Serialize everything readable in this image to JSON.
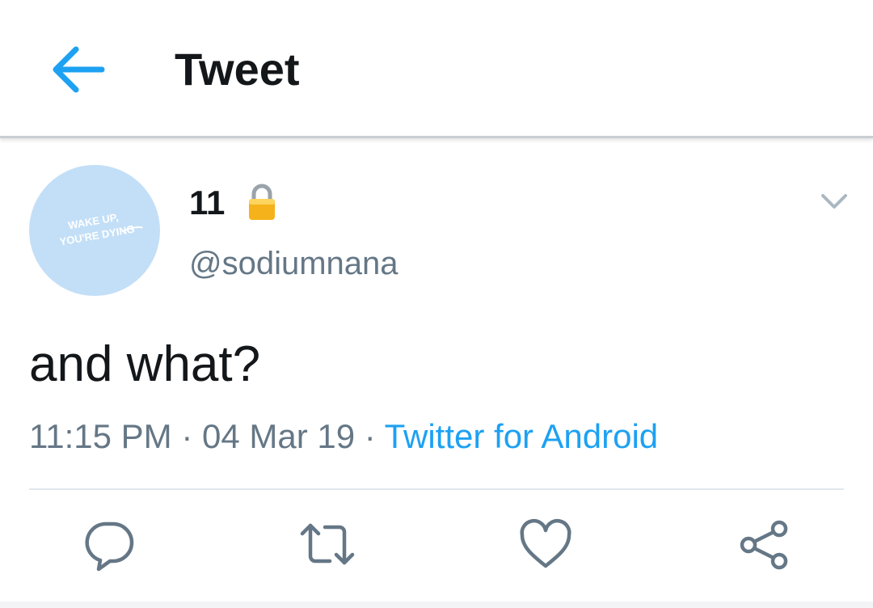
{
  "header": {
    "title": "Tweet",
    "back_icon": "arrow-left-icon"
  },
  "tweet": {
    "author": {
      "display_name": "11",
      "handle": "@sodiumnana",
      "protected_icon": "lock-icon",
      "avatar": {
        "line1": "WAKE UP,",
        "line2": "YOU'RE DYING"
      }
    },
    "text": "and what?",
    "meta": {
      "time": "11:15 PM",
      "separator": " · ",
      "date": "04 Mar 19",
      "source": "Twitter for Android"
    },
    "actions": [
      {
        "name": "reply",
        "icon": "reply-icon"
      },
      {
        "name": "retweet",
        "icon": "retweet-icon"
      },
      {
        "name": "like",
        "icon": "heart-icon"
      },
      {
        "name": "share",
        "icon": "share-icon"
      }
    ]
  },
  "colors": {
    "accent": "#1da1f2",
    "text_primary": "#14171a",
    "text_secondary": "#657786",
    "icon_gray": "#657786",
    "avatar_bg": "#c3dff7",
    "divider": "#e1e8ed"
  }
}
